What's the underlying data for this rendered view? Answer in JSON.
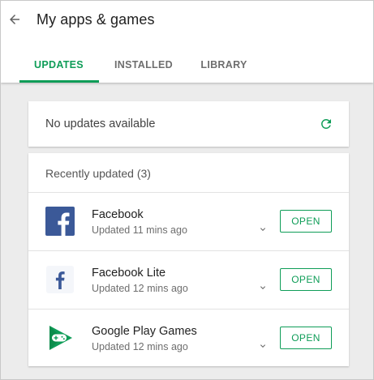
{
  "header": {
    "title": "My apps & games",
    "tabs": [
      {
        "label": "UPDATES",
        "active": true
      },
      {
        "label": "INSTALLED",
        "active": false
      },
      {
        "label": "LIBRARY",
        "active": false
      }
    ]
  },
  "status_card": {
    "text": "No updates available",
    "icon": "refresh-icon"
  },
  "recent": {
    "header": "Recently updated (3)",
    "open_label": "OPEN",
    "apps": [
      {
        "name": "Facebook",
        "subtitle": "Updated 11 mins ago",
        "icon": "facebook-icon"
      },
      {
        "name": "Facebook Lite",
        "subtitle": "Updated 12 mins ago",
        "icon": "facebook-lite-icon"
      },
      {
        "name": "Google Play Games",
        "subtitle": "Updated 12 mins ago",
        "icon": "play-games-icon"
      }
    ]
  },
  "colors": {
    "accent": "#0f9d58",
    "facebook_blue": "#3b5998"
  }
}
